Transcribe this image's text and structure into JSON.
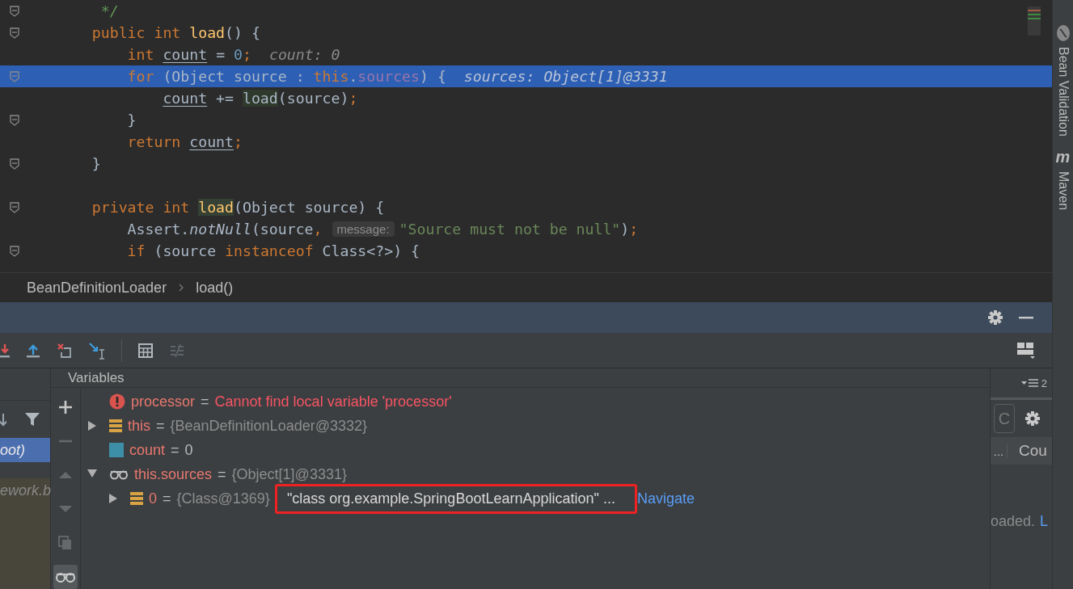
{
  "editor": {
    "lines": [
      {
        "fold": true,
        "selected": false,
        "segments": [
          {
            "kind": "code",
            "tokens": [
              {
                "text": "     */",
                "kind": "comment"
              }
            ]
          }
        ]
      },
      {
        "fold": true,
        "selected": false,
        "segments": [
          {
            "kind": "code",
            "tokens": [
              {
                "text": "    public int ",
                "kind": "kw"
              },
              {
                "text": "load",
                "kind": "method_decl"
              },
              {
                "text": "() {",
                "kind": "plain"
              }
            ]
          }
        ]
      },
      {
        "fold": false,
        "selected": false,
        "segments": [
          {
            "kind": "code",
            "tokens": [
              {
                "text": "        int ",
                "kind": "kw"
              },
              {
                "text": "count",
                "kind": "local"
              },
              {
                "text": " = ",
                "kind": "plain"
              },
              {
                "text": "0",
                "kind": "num"
              },
              {
                "text": ";",
                "kind": "kw"
              }
            ]
          }
        ],
        "inline_value": "count: 0"
      },
      {
        "fold": true,
        "selected": true,
        "segments": [
          {
            "kind": "code",
            "tokens": [
              {
                "text": "        for ",
                "kind": "kw"
              },
              {
                "text": "(Object source : ",
                "kind": "plain"
              },
              {
                "text": "this",
                "kind": "kw"
              },
              {
                "text": ".",
                "kind": "plain"
              },
              {
                "text": "sources",
                "kind": "field"
              },
              {
                "text": ") {",
                "kind": "plain"
              }
            ]
          }
        ],
        "inline_value": "sources: Object[1]@3331"
      },
      {
        "fold": false,
        "selected": false,
        "segments": [
          {
            "kind": "code",
            "tokens": [
              {
                "text": "            count",
                "kind": "local"
              },
              {
                "text": " += ",
                "kind": "plain"
              },
              {
                "text": "load",
                "kind": "usage"
              },
              {
                "text": "(source)",
                "kind": "plain"
              },
              {
                "text": ";",
                "kind": "kw"
              }
            ]
          }
        ]
      },
      {
        "fold": true,
        "selected": false,
        "segments": [
          {
            "kind": "code",
            "tokens": [
              {
                "text": "        }",
                "kind": "plain"
              }
            ]
          }
        ]
      },
      {
        "fold": false,
        "selected": false,
        "segments": [
          {
            "kind": "code",
            "tokens": [
              {
                "text": "        return ",
                "kind": "kw"
              },
              {
                "text": "count",
                "kind": "local"
              },
              {
                "text": ";",
                "kind": "kw"
              }
            ]
          }
        ]
      },
      {
        "fold": true,
        "selected": false,
        "segments": [
          {
            "kind": "code",
            "tokens": [
              {
                "text": "    }",
                "kind": "plain"
              }
            ]
          }
        ]
      },
      {
        "fold": false,
        "selected": false
      },
      {
        "fold": true,
        "selected": false,
        "segments": [
          {
            "kind": "code",
            "tokens": [
              {
                "text": "    private int ",
                "kind": "kw"
              },
              {
                "text": "load",
                "kind": "method_decl_usage"
              },
              {
                "text": "(Object source) {",
                "kind": "plain"
              }
            ]
          }
        ]
      },
      {
        "fold": false,
        "selected": false,
        "segments": [
          {
            "kind": "code",
            "tokens": [
              {
                "text": "        Assert.",
                "kind": "plain"
              },
              {
                "text": "notNull",
                "kind": "static"
              },
              {
                "text": "(source",
                "kind": "plain"
              },
              {
                "text": ",",
                "kind": "kw"
              }
            ]
          },
          {
            "kind": "param_hint",
            "text": "message:"
          },
          {
            "kind": "code",
            "tokens": [
              {
                "text": "\"Source must not be null\"",
                "kind": "str"
              },
              {
                "text": ")",
                "kind": "plain"
              },
              {
                "text": ";",
                "kind": "kw"
              }
            ]
          }
        ]
      },
      {
        "fold": true,
        "selected": false,
        "segments": [
          {
            "kind": "code",
            "tokens": [
              {
                "text": "        if ",
                "kind": "kw"
              },
              {
                "text": "(source ",
                "kind": "plain"
              },
              {
                "text": "instanceof ",
                "kind": "kw"
              },
              {
                "text": "Class<?>) {",
                "kind": "plain"
              }
            ]
          }
        ]
      }
    ]
  },
  "breadcrumbs": [
    {
      "label": "BeanDefinitionLoader"
    },
    {
      "label": "load()"
    }
  ],
  "toolbar": [
    {
      "kind": "step_into",
      "disabled": false
    },
    {
      "kind": "step_out",
      "disabled": false
    },
    {
      "kind": "drop_frame",
      "disabled": false
    },
    {
      "kind": "run_to_cursor",
      "disabled": false
    },
    {
      "kind": "separator"
    },
    {
      "kind": "evaluate",
      "disabled": false
    },
    {
      "kind": "trace",
      "disabled": true
    }
  ],
  "frames": [
    {
      "text": "oot)",
      "selected": true,
      "library": false
    },
    {
      "text": "ework.b",
      "selected": false,
      "library": true
    }
  ],
  "variables": {
    "title": "Variables",
    "side_tools": [
      {
        "kind": "add",
        "disabled": false,
        "selected": false
      },
      {
        "kind": "remove",
        "disabled": true,
        "selected": false
      },
      {
        "kind": "up",
        "disabled": true,
        "selected": false
      },
      {
        "kind": "down",
        "disabled": true,
        "selected": false
      },
      {
        "kind": "copy",
        "disabled": true,
        "selected": false
      },
      {
        "kind": "watches",
        "disabled": false,
        "selected": true
      }
    ],
    "rows": [
      {
        "kind": "error",
        "has_children": false,
        "name": "processor",
        "op": "=",
        "value": [
          {
            "text": "Cannot find local variable 'processor'",
            "kind": "error"
          }
        ]
      },
      {
        "kind": "object",
        "has_children": true,
        "expanded": false,
        "name": "this",
        "op": "=",
        "value": [
          {
            "text": "{BeanDefinitionLoader@3332}",
            "kind": "ref"
          }
        ]
      },
      {
        "kind": "primitive",
        "has_children": false,
        "name": "count",
        "op": "=",
        "value": [
          {
            "text": "0",
            "kind": "plain"
          }
        ]
      },
      {
        "kind": "watch",
        "has_children": true,
        "expanded": true,
        "name": "this.sources",
        "op": "=",
        "value": [
          {
            "text": "{Object[1]@3331}",
            "kind": "ref"
          }
        ],
        "children": [
          {
            "kind": "object",
            "has_children": true,
            "expanded": false,
            "name": "0",
            "op": "=",
            "value": [
              {
                "text": "{Class@1369}",
                "kind": "ref"
              },
              {
                "text": "\"class org.example.SpringBootLearnApplication\" ...",
                "kind": "framed"
              },
              {
                "text": "Navigate",
                "kind": "link"
              }
            ]
          }
        ]
      }
    ]
  },
  "threads": {
    "count": "2",
    "field_value": "C",
    "column_1": "...",
    "column_2": "Cou",
    "message": "oaded.",
    "link": "L"
  },
  "side_strip": [
    {
      "label": "Bean Validation",
      "kind": "bean"
    },
    {
      "label": "Maven",
      "kind": "letter",
      "icon_text": "m"
    }
  ]
}
